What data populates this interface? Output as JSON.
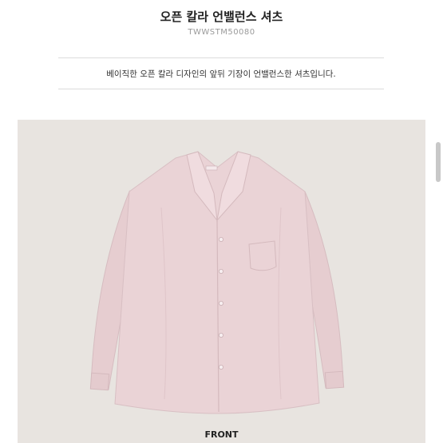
{
  "product": {
    "title": "오픈 칼라 언밸런스 셔츠",
    "code": "TWWSTM50080",
    "description": "베이직한 오픈 칼라 디자인의 앞뒤 기장이 언밸런스한 셔츠입니다."
  },
  "image": {
    "caption": "FRONT",
    "background_color": "#e8e4e0",
    "shirt_color": "#e9d2d4",
    "icon": "shirt-front-photo"
  }
}
